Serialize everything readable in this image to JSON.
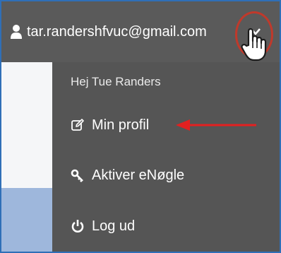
{
  "header": {
    "user_email": "tar.randershfvuc@gmail.com",
    "user_icon": "user-icon",
    "caret_icon": "chevron-down-icon"
  },
  "dropdown": {
    "greeting": "Hej Tue Randers",
    "items": [
      {
        "label": "Min profil",
        "icon": "edit-icon"
      },
      {
        "label": "Aktiver eNøgle",
        "icon": "key-icon"
      },
      {
        "label": "Log ud",
        "icon": "power-icon"
      }
    ]
  },
  "annotations": {
    "highlight_color": "#c0392b",
    "arrow_color": "#e32020",
    "cursor": "hand-pointer-cursor"
  },
  "colors": {
    "topbar_bg": "#5a5a5a",
    "dropdown_bg": "#555555",
    "frame_border": "#2f6fb7"
  }
}
